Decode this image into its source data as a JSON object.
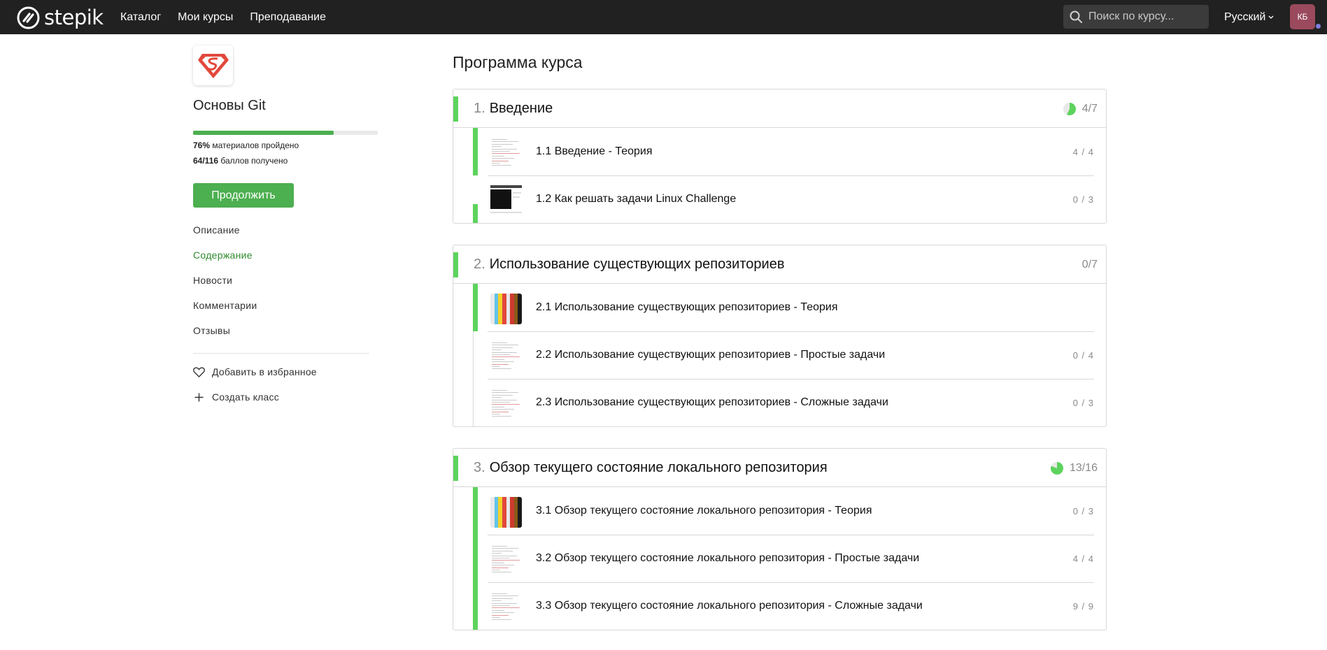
{
  "header": {
    "logo_text": "stepik",
    "nav": [
      "Каталог",
      "Мои курсы",
      "Преподавание"
    ],
    "search_placeholder": "Поиск по курсу...",
    "language": "Русский",
    "avatar_initials": "КБ"
  },
  "sidebar": {
    "course_title": "Основы Git",
    "progress_fraction": 0.76,
    "materials_pct": "76%",
    "materials_label": "материалов пройдено",
    "score": "64/116",
    "score_label": "баллов получено",
    "continue_label": "Продолжить",
    "nav": [
      {
        "label": "Описание",
        "active": false
      },
      {
        "label": "Содержание",
        "active": true
      },
      {
        "label": "Новости",
        "active": false
      },
      {
        "label": "Комментарии",
        "active": false
      },
      {
        "label": "Отзывы",
        "active": false
      }
    ],
    "favorite_label": "Добавить в избранное",
    "create_class_label": "Создать класс"
  },
  "main": {
    "title": "Программа курса",
    "modules": [
      {
        "num": "1.",
        "title": "Введение",
        "score": "4/7",
        "progress_fraction": 0.57,
        "lessons": [
          {
            "title": "1.1 Введение - Теория",
            "score": "4 / 4",
            "thumb": "doc",
            "bar": "on"
          },
          {
            "title": "1.2 Как решать задачи Linux Challenge",
            "score": "0 / 3",
            "thumb": "terminal",
            "bar": "half"
          }
        ]
      },
      {
        "num": "2.",
        "title": "Использование существующих репозиториев",
        "score": "0/7",
        "progress_fraction": 0,
        "lessons": [
          {
            "title": "2.1 Использование существующих репозиториев - Теория",
            "score": "",
            "thumb": "bars",
            "bar": "on"
          },
          {
            "title": "2.2 Использование существующих репозиториев - Простые задачи",
            "score": "0 / 4",
            "thumb": "doc",
            "bar": "off"
          },
          {
            "title": "2.3 Использование существующих репозиториев - Сложные задачи",
            "score": "0 / 3",
            "thumb": "doc",
            "bar": "off"
          }
        ]
      },
      {
        "num": "3.",
        "title": "Обзор текущего состояние локального репозитория",
        "score": "13/16",
        "progress_fraction": 0.81,
        "lessons": [
          {
            "title": "3.1 Обзор текущего состояние локального репозитория - Теория",
            "score": "0 / 3",
            "thumb": "bars",
            "bar": "on"
          },
          {
            "title": "3.2 Обзор текущего состояние локального репозитория - Простые задачи",
            "score": "4 / 4",
            "thumb": "doc",
            "bar": "on"
          },
          {
            "title": "3.3 Обзор текущего состояние локального репозитория - Сложные задачи",
            "score": "9 / 9",
            "thumb": "doc",
            "bar": "on"
          }
        ]
      }
    ]
  },
  "colors": {
    "topbar": "#212121",
    "accent_green": "#4caf50",
    "progress_green": "#5dd35d",
    "active_nav": "#2e8b2e"
  }
}
